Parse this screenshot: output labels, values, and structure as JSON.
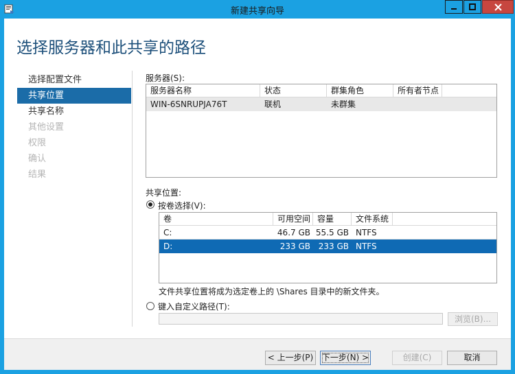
{
  "window": {
    "title": "新建共享向导"
  },
  "page": {
    "heading": "选择服务器和此共享的路径"
  },
  "nav": {
    "items": [
      {
        "label": "选择配置文件",
        "state": "normal"
      },
      {
        "label": "共享位置",
        "state": "active"
      },
      {
        "label": "共享名称",
        "state": "normal"
      },
      {
        "label": "其他设置",
        "state": "disabled"
      },
      {
        "label": "权限",
        "state": "disabled"
      },
      {
        "label": "确认",
        "state": "disabled"
      },
      {
        "label": "结果",
        "state": "disabled"
      }
    ]
  },
  "servers": {
    "label": "服务器(S):",
    "columns": [
      "服务器名称",
      "状态",
      "群集角色",
      "所有者节点"
    ],
    "rows": [
      {
        "name": "WIN-6SNRUPJA76T",
        "status": "联机",
        "role": "未群集",
        "owner": ""
      }
    ]
  },
  "location": {
    "label": "共享位置:",
    "by_volume_label": "按卷选择(V):",
    "volumes": {
      "columns": [
        "卷",
        "可用空间",
        "容量",
        "文件系统"
      ],
      "rows": [
        {
          "volume": "C:",
          "free": "46.7 GB",
          "capacity": "55.5 GB",
          "fs": "NTFS"
        },
        {
          "volume": "D:",
          "free": "233 GB",
          "capacity": "233 GB",
          "fs": "NTFS"
        }
      ]
    },
    "note": "文件共享位置将成为选定卷上的 \\Shares 目录中的新文件夹。",
    "custom_path_label": "键入自定义路径(T):",
    "custom_path_value": "",
    "browse_label": "浏览(B)..."
  },
  "footer": {
    "prev_label": "< 上一步(P)",
    "next_label": "下一步(N) >",
    "create_label": "创建(C)",
    "cancel_label": "取消"
  },
  "colors": {
    "accent": "#1ba1e2",
    "selection": "#0f6ab4",
    "heading": "#1c4f7a"
  }
}
